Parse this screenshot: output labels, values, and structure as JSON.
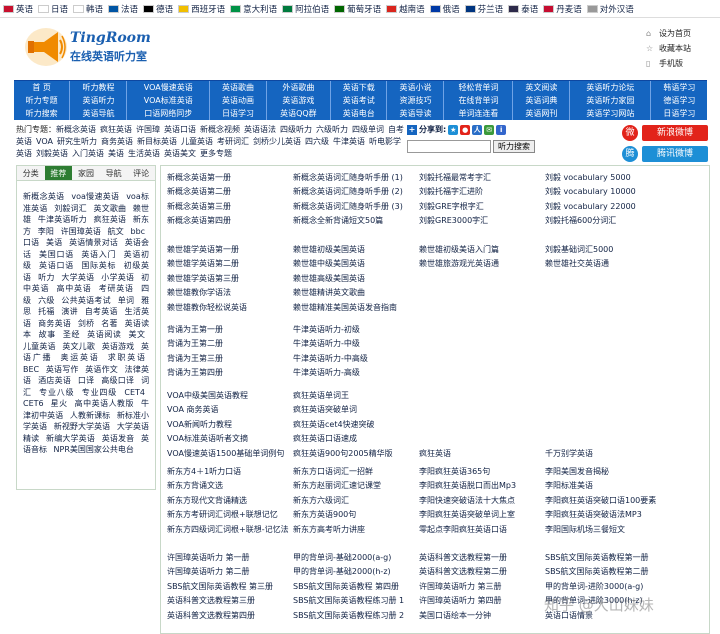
{
  "langbar": [
    {
      "label": "英语",
      "color": "#c8102e"
    },
    {
      "label": "日语",
      "color": "#ffffff"
    },
    {
      "label": "韩语",
      "color": "#ffffff"
    },
    {
      "label": "法语",
      "color": "#0055a4"
    },
    {
      "label": "德语",
      "color": "#000000"
    },
    {
      "label": "西班牙语",
      "color": "#f1bf00"
    },
    {
      "label": "意大利语",
      "color": "#009246"
    },
    {
      "label": "阿拉伯语",
      "color": "#007a3d"
    },
    {
      "label": "葡萄牙语",
      "color": "#006600"
    },
    {
      "label": "越南语",
      "color": "#da251d"
    },
    {
      "label": "俄语",
      "color": "#0039a6"
    },
    {
      "label": "芬兰语",
      "color": "#003580"
    },
    {
      "label": "泰语",
      "color": "#2d2a4a"
    },
    {
      "label": "丹麦语",
      "color": "#c60c30"
    },
    {
      "label": "对外汉语",
      "color": "#999999"
    }
  ],
  "logo": {
    "en": "TingRoom",
    "cn": "在线英语听力室"
  },
  "toplinks": [
    {
      "icon": "home-icon",
      "label": "设为首页"
    },
    {
      "icon": "star-icon",
      "label": "收藏本站"
    },
    {
      "icon": "mobile-icon",
      "label": "手机版"
    }
  ],
  "nav": [
    [
      "首 页",
      "听力教程",
      "VOA慢速英语",
      "英语歌曲",
      "外语歌曲",
      "英语下载",
      "英语小说",
      "轻松背单词",
      "英文阅读",
      "英语听力论坛",
      "韩语学习"
    ],
    [
      "听力专题",
      "英语听力",
      "VOA标准英语",
      "英语动画",
      "英语游戏",
      "英语考试",
      "资源技巧",
      "在线背单词",
      "英语词典",
      "英语听力家园",
      "德语学习"
    ],
    [
      "听力搜索",
      "英语导航",
      "口语网络同步",
      "日语学习",
      "英语QQ群",
      "英语电台",
      "英语导读",
      "单词连连看",
      "英语网刊",
      "英语学习网站",
      "日语学习"
    ]
  ],
  "hot": {
    "label": "热门专题：",
    "items": [
      "新概念英语",
      "疯狂英语",
      "许国璋",
      "英语口语",
      "新概念视频",
      "英语语法",
      "四级听力",
      "六级听力",
      "四级单词",
      "自考英语",
      "VOA",
      "研究生听力",
      "商务英语",
      "新目标英语",
      "儿童英语",
      "考研词汇",
      "剑桥少儿英语",
      "四六级",
      "牛津英语",
      "听电影学英语",
      "刘毅英语",
      "入门英语",
      "美语",
      "生活英语",
      "英语美文",
      "更多专题"
    ]
  },
  "share": {
    "title": "分享到:",
    "search_placeholder": "",
    "search_button": "听力搜索"
  },
  "weibo": [
    {
      "label": "新浪微博",
      "color": "#e2231a",
      "icon": "sina-weibo-icon"
    },
    {
      "label": "腾讯微博",
      "color": "#1d8fd6",
      "icon": "tencent-weibo-icon"
    }
  ],
  "left": {
    "tabs": [
      "分类",
      "推荐",
      "家园",
      "导航",
      "评论"
    ],
    "links": [
      "新概念英语",
      "voa慢速英语",
      "voa标准英语",
      "刘毅词汇",
      "英文歌曲",
      "赖世雄",
      "牛津英语听力",
      "疯狂英语",
      "新东方",
      "李阳",
      "许国璋英语",
      "航文",
      "bbc",
      "口语",
      "美语",
      "英语情景对话",
      "英语会话",
      "美国口语",
      "英语入门",
      "英语初级",
      "英语口语",
      "国际英标",
      "初级英语",
      "听力",
      "大学英语",
      "小学英语",
      "初中英语",
      "高中英语",
      "考研英语",
      "四级",
      "六级",
      "公共英语考试",
      "单词",
      "雅思",
      "托福",
      "演讲",
      "自考英语",
      "生活英语",
      "商务英语",
      "剑桥",
      "名著",
      "英语读本",
      "故事",
      "圣经",
      "英语阅读",
      "美文",
      "儿童英语",
      "英文儿歌",
      "英语游戏",
      "英语广播",
      "奥运英语",
      "求职英语",
      "BEC",
      "英语写作",
      "英语作文",
      "法律英语",
      "酒店英语",
      "口译",
      "高级口译",
      "词汇",
      "专业八级",
      "专业四级",
      "CET4",
      "CET6",
      "星火",
      "高中英语人教版",
      "牛津初中英语",
      "人教新课标",
      "新标准小学英语",
      "新视野大学英语",
      "大学英语精读",
      "新编大学英语",
      "英语发音",
      "英语音标",
      "NPR美国国家公共电台"
    ]
  },
  "main": {
    "groups": [
      {
        "rows": [
          [
            "新概念英语第一册",
            "新概念英语词汇随身听手册 (1)",
            "刘毅托福最常考字汇",
            "刘毅 vocabulary 5000"
          ],
          [
            "新概念英语第二册",
            "新概念英语词汇随身听手册 (2)",
            "刘毅托福字汇进阶",
            "刘毅 vocabulary 10000"
          ],
          [
            "新概念英语第三册",
            "新概念英语词汇随身听手册 (3)",
            "刘毅GRE字根字汇",
            "刘毅 vocabulary 22000"
          ],
          [
            "新概念英语第四册",
            "新概念全新背诵短文50篇",
            "刘毅GRE3000字汇",
            "刘毅托福600分词汇"
          ]
        ]
      },
      {
        "rows": [
          [
            "赖世雄学英语第一册",
            "赖世雄初级美国英语",
            "赖世雄初级美语入门篇",
            "刘毅基础词汇5000"
          ],
          [
            "赖世雄学英语第二册",
            "赖世雄中级美国英语",
            "赖世雄旅游观光英语通",
            "赖世雄社交英语通"
          ],
          [
            "赖世雄学英语第三册",
            "赖世雄高级美国英语",
            "",
            ""
          ],
          [
            "赖世雄教你学语法",
            "赖世雄精讲英文歌曲",
            "",
            ""
          ],
          [
            "赖世雄教你轻松说英语",
            "赖世雄精准美国英语发音指南",
            "",
            ""
          ]
        ]
      },
      {
        "rows": [
          [
            "背诵为王第一册",
            "牛津英语听力-初级",
            "",
            ""
          ],
          [
            "背诵为王第二册",
            "牛津英语听力-中级",
            "",
            ""
          ],
          [
            "背诵为王第三册",
            "牛津英语听力-中高级",
            "",
            ""
          ],
          [
            "背诵为王第四册",
            "牛津英语听力-高级",
            "",
            ""
          ]
        ]
      },
      {
        "rows": [
          [
            "VOA中级美国英语教程",
            "疯狂英语单词王",
            "",
            ""
          ],
          [
            "VOA 商务英语",
            "疯狂英语突破单词",
            "",
            ""
          ],
          [
            "VOA新闻听力教程",
            "疯狂英语cet4快速突破",
            "",
            ""
          ],
          [
            "VOA标准英语听者文摘",
            "疯狂英语口语速成",
            "",
            ""
          ],
          [
            "VOA慢速英语1500基础单词例句",
            "疯狂英语900句2005精华版",
            "疯狂英语",
            "千万别学英语"
          ]
        ]
      },
      {
        "rows": [
          [
            "新东方4＋1听力口语",
            "新东方口语词汇一招鲜",
            "李阳疯狂英语365句",
            "李阳美国发音揭秘"
          ],
          [
            "新东方背诵文选",
            "新东方赵丽词汇速记课堂",
            "李阳疯狂英语脱口而出Mp3",
            "李阳标准美语"
          ],
          [
            "新东方现代文背诵精选",
            "新东方六级词汇",
            "李阳快速突破语法十大焦点",
            "李阳疯狂英语突破口语100要素"
          ],
          [
            "新东方考研词汇词根+联想记忆",
            "新东方英语900句",
            "李阳疯狂英语突破单词上室",
            "李阳疯狂英语突破语法MP3"
          ],
          [
            "新东方四级词汇词根+联想-记忆法",
            "新东方高考听力讲座",
            "零起点李阳疯狂英语口语",
            "李阳国际机场三餐短文"
          ]
        ]
      },
      {
        "rows": [
          [
            "许国璋英语听力 第一册",
            "甲的背单词-基础2000(a-g)",
            "英语科普文选教程第一册",
            "SBS航文国际英语教程第一册"
          ],
          [
            "许国璋英语听力 第二册",
            "甲的背单词-基础2000(h-z)",
            "英语科普文选教程第二册",
            "SBS航文国际英语教程第二册"
          ],
          [
            "SBS航文国际英语教程 第三册",
            "SBS航文国际英语教程 第四册",
            "许国璋英语听力 第三册",
            "甲的背单词-进阶3000(a-g)"
          ],
          [
            "英语科普文选教程第三册",
            "SBS航文国际英语教程练习册 1",
            "许国璋英语听力 第四册",
            "甲的背单词-进阶3000(h-z)"
          ],
          [
            "英语科普文选教程第四册",
            "SBS航文国际英语教程练习册 2",
            "美国口语绘本一分钟",
            "英语口语情景"
          ]
        ]
      }
    ]
  },
  "watermark": "知乎 @大山妹妹"
}
